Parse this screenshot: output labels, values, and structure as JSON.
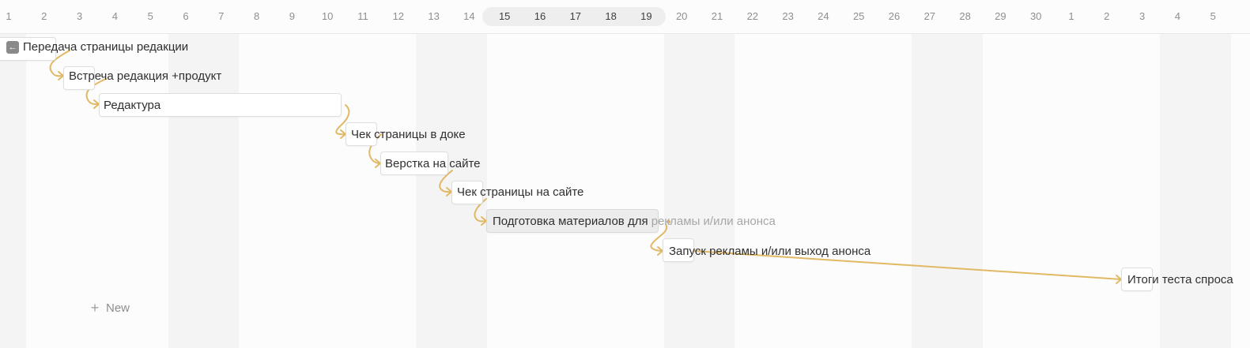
{
  "timeline": {
    "days": [
      "1",
      "2",
      "3",
      "4",
      "5",
      "6",
      "7",
      "8",
      "9",
      "10",
      "11",
      "12",
      "13",
      "14",
      "15",
      "16",
      "17",
      "18",
      "19",
      "20",
      "21",
      "22",
      "23",
      "24",
      "25",
      "26",
      "27",
      "28",
      "29",
      "30",
      "1",
      "2",
      "3",
      "4",
      "5"
    ],
    "highlight_range": [
      "15",
      "19"
    ],
    "new_label": "New",
    "back_icon": "arrow-left-icon",
    "connector_color": "#e1b965",
    "tasks": [
      {
        "name": "Передача страницы редакции",
        "truncated_tail": "",
        "start_day": "1",
        "end_day": "2",
        "style": "white"
      },
      {
        "name": "Встреча редакция +продукт",
        "truncated_tail": "",
        "start_day": "3",
        "end_day": "3",
        "style": "white"
      },
      {
        "name": "Редактура",
        "truncated_tail": "",
        "start_day": "4",
        "end_day": "10",
        "style": "white"
      },
      {
        "name": "Чек страницы в доке",
        "truncated_tail": "",
        "start_day": "11",
        "end_day": "11",
        "style": "white"
      },
      {
        "name": "Верстка на сайте",
        "truncated_tail": "",
        "start_day": "12",
        "end_day": "13",
        "style": "white"
      },
      {
        "name": "Чек страницы на сайте",
        "truncated_tail": "",
        "start_day": "14",
        "end_day": "14",
        "style": "white"
      },
      {
        "name": "Подготовка материалов для",
        "truncated_tail": "рекламы и/или анонса",
        "start_day": "15",
        "end_day": "19",
        "style": "gray"
      },
      {
        "name": "Запуск рекламы и/или выход анонса",
        "truncated_tail": "",
        "start_day": "20",
        "end_day": "20",
        "style": "white"
      },
      {
        "name": "Итоги теста спроса",
        "truncated_tail": "",
        "start_day": "3",
        "end_day": "3",
        "style": "white"
      }
    ]
  }
}
